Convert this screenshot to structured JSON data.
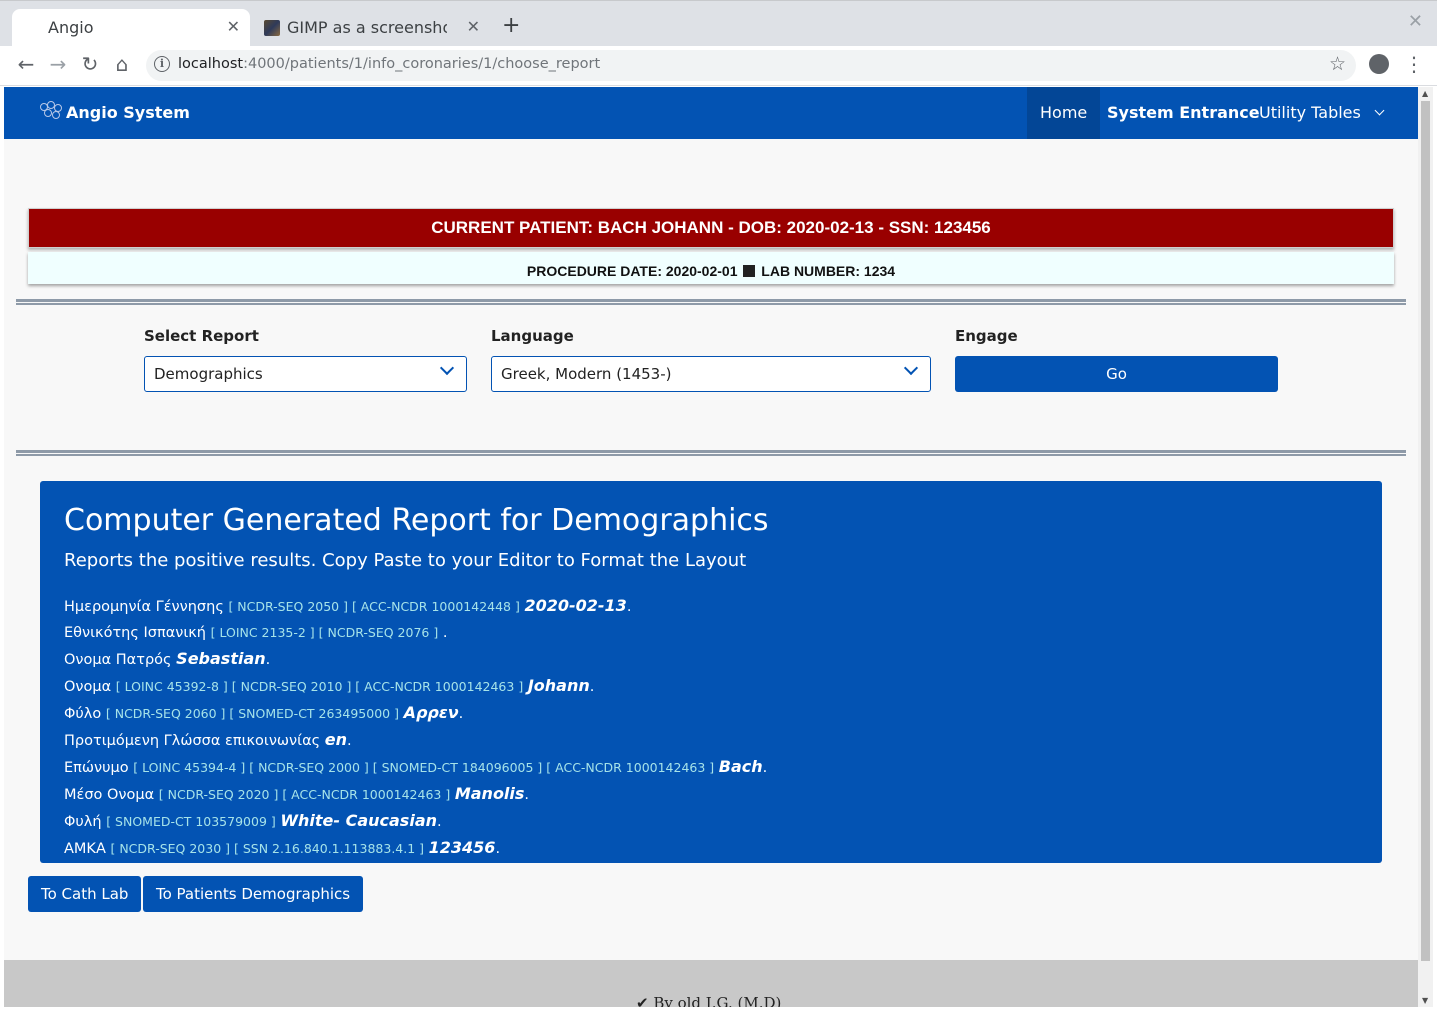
{
  "browser": {
    "tabs": [
      {
        "title": "Angio",
        "active": true
      },
      {
        "title": "GIMP as a screenshot t",
        "active": false
      }
    ],
    "url_host": "localhost",
    "url_path": ":4000/patients/1/info_coronaries/1/choose_report"
  },
  "navbar": {
    "brand": "Angio System",
    "items": [
      {
        "label": "Home"
      },
      {
        "label": "System Entrance"
      },
      {
        "label": "Utility Tables"
      }
    ]
  },
  "patient_banner": "CURRENT PATIENT: BACH JOHANN - DOB: 2020-02-13 - SSN: 123456",
  "procedure": {
    "date_text": "PROCEDURE DATE: 2020-02-01",
    "lab_text": "LAB NUMBER: 1234"
  },
  "form": {
    "report_label": "Select Report",
    "report_value": "Demographics",
    "language_label": "Language",
    "language_value": "Greek, Modern (1453-)",
    "engage_label": "Engage",
    "go_label": "Go"
  },
  "report": {
    "title": "Computer Generated Report for Demographics",
    "lead": "Reports the positive results. Copy Paste to your Editor to Format the Layout",
    "rows": [
      {
        "label": "Ημερομηνία Γέννησης",
        "codes": "[ NCDR-SEQ 2050 ] [ ACC-NCDR 1000142448 ]",
        "value": "2020-02-13",
        "end": "."
      },
      {
        "label": "Εθνικότης Ισπανική",
        "codes": "[ LOINC 2135-2 ] [ NCDR-SEQ 2076 ]",
        "value": "",
        "end": " ."
      },
      {
        "label": "Ονομα Πατρός",
        "codes": "",
        "value": "Sebastian",
        "end": "."
      },
      {
        "label": "Ονομα",
        "codes": "[ LOINC 45392-8 ] [ NCDR-SEQ 2010 ] [ ACC-NCDR 1000142463 ]",
        "value": "Johann",
        "end": "."
      },
      {
        "label": "Φύλο",
        "codes": "[ NCDR-SEQ 2060 ] [ SNOMED-CT 263495000 ]",
        "value": "Αρρεν",
        "end": "."
      },
      {
        "label": "Προτιμόμενη Γλώσσα επικοινωνίας",
        "codes": "",
        "value": "en",
        "end": "."
      },
      {
        "label": "Επώνυμο",
        "codes": "[ LOINC 45394-4 ] [ NCDR-SEQ 2000 ] [ SNOMED-CT 184096005 ] [ ACC-NCDR 1000142463 ]",
        "value": "Bach",
        "end": "."
      },
      {
        "label": "Μέσο Ονομα",
        "codes": "[ NCDR-SEQ 2020 ] [ ACC-NCDR 1000142463 ]",
        "value": "Manolis",
        "end": "."
      },
      {
        "label": "Φυλή",
        "codes": "[ SNOMED-CT 103579009 ]",
        "value": "White- Caucasian",
        "end": "."
      },
      {
        "label": "ΑΜΚΑ",
        "codes": "[ NCDR-SEQ 2030 ] [ SSN 2.16.840.1.113883.4.1 ]",
        "value": "123456",
        "end": "."
      }
    ]
  },
  "buttons": {
    "cath_lab": "To Cath Lab",
    "patients_demographics": "To Patients Demographics"
  },
  "footer": {
    "by": "✔ By old I.G. (M.D)"
  },
  "colors": {
    "primary": "#0353b3",
    "banner": "#990000",
    "code_text": "#a6e3e9"
  }
}
